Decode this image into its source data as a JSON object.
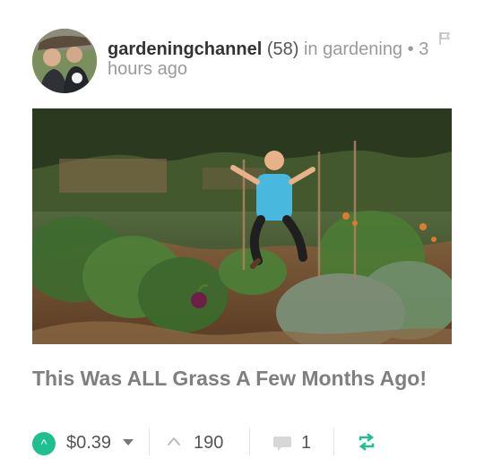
{
  "post": {
    "author": "gardeningchannel",
    "reputation": "(58)",
    "category_prefix": "in",
    "category": "gardening",
    "separator": "•",
    "time": "3 hours ago",
    "title": "This Was ALL Grass A Few Months Ago!",
    "payout": "$0.39",
    "votes": "190",
    "comments": "1"
  },
  "icons": {
    "flag": "flag-icon",
    "upvote": "upvote-circle-icon",
    "votes": "chevron-up-icon",
    "comments": "comment-icon",
    "resteem": "resteem-icon",
    "caret": "caret-down-icon"
  },
  "colors": {
    "accent": "#1fbf8f",
    "title": "#7f7f7f",
    "muted": "#9a9a9a"
  }
}
